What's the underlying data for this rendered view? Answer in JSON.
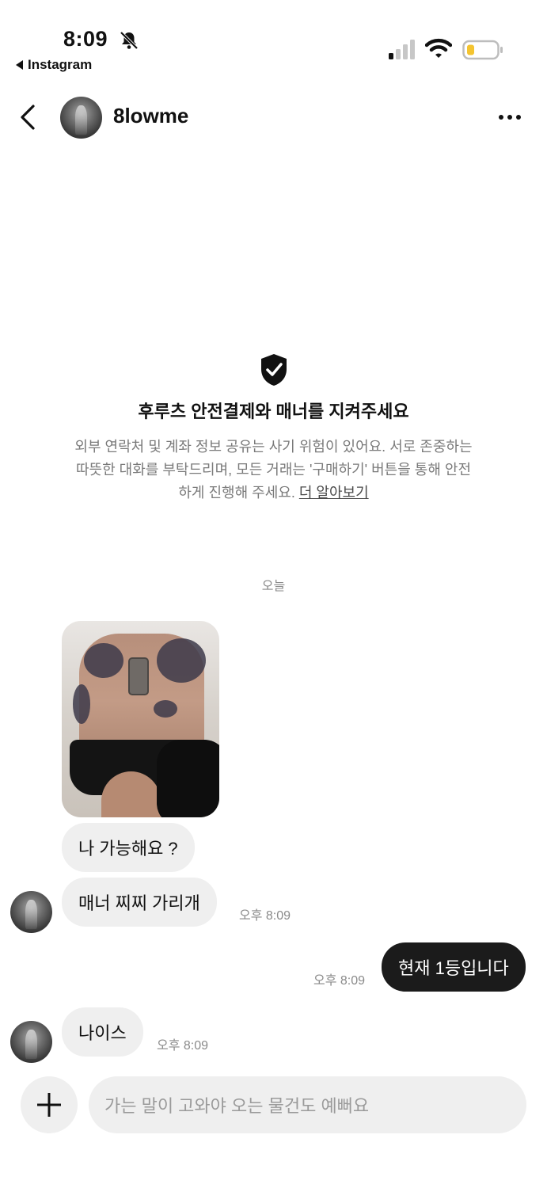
{
  "status_bar": {
    "time": "8:09",
    "back_app_label": "Instagram",
    "icons": [
      "bell-slash-icon",
      "signal-icon",
      "wifi-icon",
      "battery-icon"
    ],
    "battery_color": "#f4c430"
  },
  "header": {
    "username": "8lowme",
    "icons": [
      "chevron-left-icon",
      "more-icon"
    ]
  },
  "notice": {
    "icon": "shield-check-icon",
    "title": "후루츠 안전결제와 매너를 지켜주세요",
    "body_line1": "외부 연락처 및 계좌 정보 공유는 사기 위험이 있어요. 서로 존중하는",
    "body_line2": "따뜻한 대화를 부탁드리며, 모든 거래는 '구매하기' 버튼을 통해 안전",
    "body_line3": "하게 진행해 주세요. ",
    "link": "더 알아보기"
  },
  "date_separator": "오늘",
  "messages": [
    {
      "side": "in",
      "type": "photo"
    },
    {
      "side": "in",
      "text": "나 가능해요 ?"
    },
    {
      "side": "in",
      "text": "매너 찌찌 가리개",
      "time": "오후 8:09"
    },
    {
      "side": "out",
      "text": "현재 1등입니다",
      "time": "오후 8:09"
    },
    {
      "side": "in",
      "text": "나이스",
      "time": "오후 8:09"
    }
  ],
  "composer": {
    "placeholder": "가는 말이 고와야 오는 물건도 예뻐요"
  },
  "colors": {
    "incoming_bubble": "#efefef",
    "outgoing_bubble": "#1b1b1b",
    "muted_text": "#8a8a8a"
  }
}
